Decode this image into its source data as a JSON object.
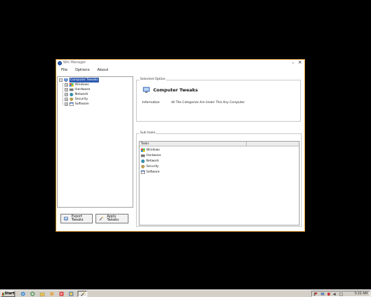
{
  "window": {
    "title": "Win Manager",
    "minimize": "–",
    "close": "✕"
  },
  "menu": [
    "File",
    "Options",
    "About"
  ],
  "tree": {
    "root": "Computer Tweaks",
    "children": [
      "Windows",
      "Hardware",
      "Network",
      "Security",
      "Software"
    ]
  },
  "buttons": {
    "export": "Export Tweaks",
    "apply": "Apply Tweaks"
  },
  "selected_option": {
    "group_title": "Selected Option",
    "heading": "Computer Tweaks",
    "info_label": "Information",
    "info_value": "All The Categories Are Under This Any Computer."
  },
  "subtasks": {
    "group_title": "Sub tasks",
    "column": "Tasks",
    "items": [
      "Windows",
      "Hardware",
      "Network",
      "Security",
      "Software"
    ]
  },
  "taskbar": {
    "start_label": "Start",
    "clock": "5:22 AM"
  },
  "colors": {
    "accent": "#e8a33b",
    "selection": "#2d5ab0"
  }
}
